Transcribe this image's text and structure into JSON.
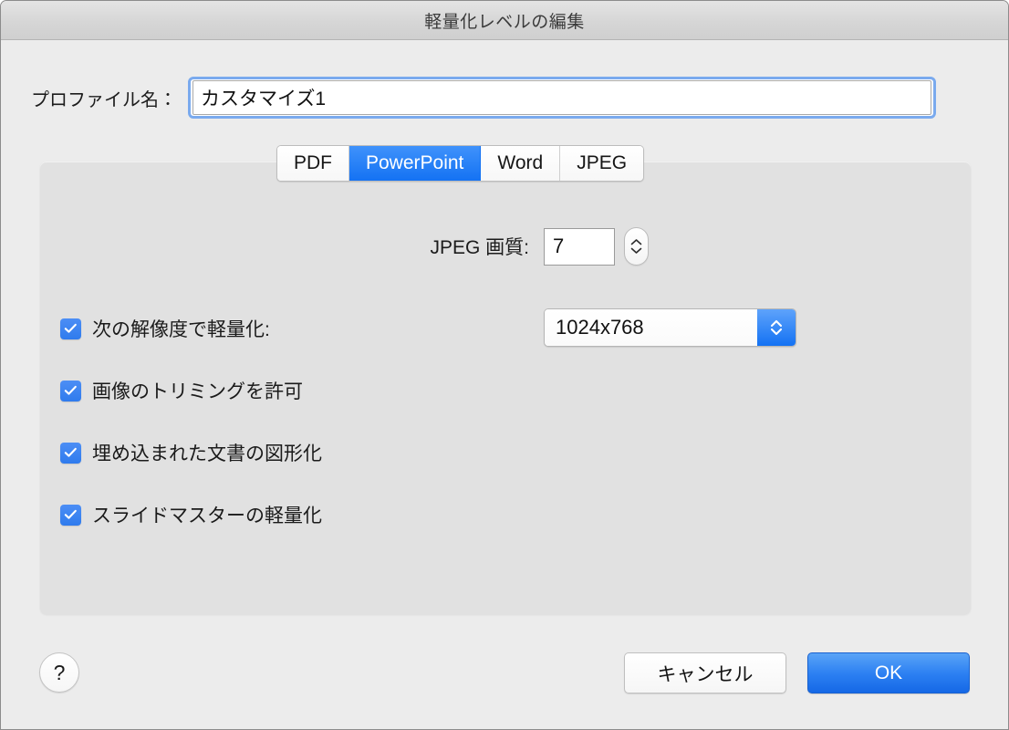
{
  "window": {
    "title": "軽量化レベルの編集"
  },
  "profile": {
    "label": "プロファイル名：",
    "value": "カスタマイズ1",
    "placeholder": "プロファイル名"
  },
  "tabs": [
    {
      "label": "PDF",
      "selected": false
    },
    {
      "label": "PowerPoint",
      "selected": true
    },
    {
      "label": "Word",
      "selected": false
    },
    {
      "label": "JPEG",
      "selected": false
    }
  ],
  "panel": {
    "quality": {
      "label": "JPEG 画質:",
      "value": "7",
      "stepper_up_icon": "chevron-up-icon",
      "stepper_down_icon": "chevron-down-icon"
    },
    "checkboxes": [
      {
        "label": "次の解像度で軽量化:",
        "checked": true
      },
      {
        "label": "画像のトリミングを許可",
        "checked": true
      },
      {
        "label": "埋め込まれた文書の図形化",
        "checked": true
      },
      {
        "label": "スライドマスターの軽量化",
        "checked": true
      }
    ],
    "resolution": {
      "value": "1024x768",
      "arrow_icon": "chevron-up-down-icon"
    }
  },
  "footer": {
    "help_label": "?",
    "cancel_label": "キャンセル",
    "ok_label": "OK"
  },
  "colors": {
    "accent_blue": "#1472f3",
    "checkbox_blue": "#2f7bed",
    "focus_ring": "#7aaaee",
    "window_background": "#ececec",
    "panel_background": "#e1e1e1"
  }
}
